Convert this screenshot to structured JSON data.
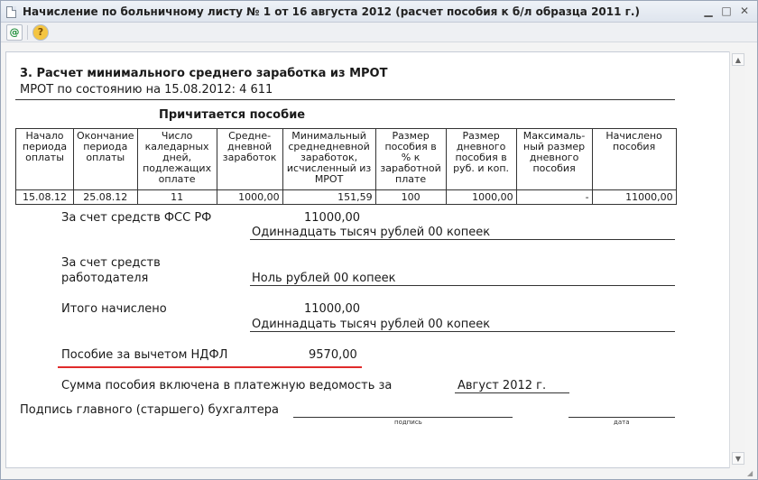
{
  "window": {
    "title": "Начисление по больничному листу № 1 от 16 августа 2012 (расчет пособия к б/л образца 2011 г.)",
    "buttons": {
      "minimize": "▁",
      "maximize": "□",
      "close": "✕"
    }
  },
  "toolbar": {
    "buttons": [
      {
        "icon": "print-preview-icon",
        "glyph": "@"
      },
      {
        "icon": "help-icon",
        "glyph": "?"
      }
    ]
  },
  "report": {
    "section_title": "3. Расчет минимального среднего заработка из МРОТ",
    "mrot_line": "МРОТ по состоянию на 15.08.2012: 4 611",
    "table_title": "Причитается пособие",
    "columns": [
      "Начало периода оплаты",
      "Окончание периода оплаты",
      "Число каледарных дней, подлежащих оплате",
      "Средне-дневной заработок",
      "Минимальный среднедневной заработок, исчисленный из МРОТ",
      "Размер пособия в % к заработной плате",
      "Размер дневного пособия в руб. и коп.",
      "Максималь-ный размер дневного пособия",
      "Начислено пособия"
    ],
    "row": [
      "15.08.12",
      "25.08.12",
      "11",
      "1000,00",
      "151,59",
      "100",
      "1000,00",
      "-",
      "11000,00"
    ],
    "fss": {
      "label": "За счет средств ФСС РФ",
      "amount": "11000,00",
      "in_words": "Одиннадцать тысяч рублей 00 копеек"
    },
    "employer": {
      "label_line1": "За счет средств",
      "label_line2": "работодателя",
      "in_words": "Ноль рублей 00 копеек"
    },
    "total": {
      "label": "Итого начислено",
      "amount": "11000,00",
      "in_words": "Одиннадцать тысяч рублей 00 копеек"
    },
    "net": {
      "label": "Пособие за вычетом НДФЛ",
      "amount": "9570,00"
    },
    "payroll": {
      "label": "Сумма пособия включена в платежную ведомость за",
      "value": "Август 2012 г."
    },
    "signature": {
      "label": "Подпись главного (старшего) бухгалтера",
      "caption_sign": "подпись",
      "caption_date": "дата"
    }
  },
  "colors": {
    "highlight_underline": "#e02b2b"
  }
}
